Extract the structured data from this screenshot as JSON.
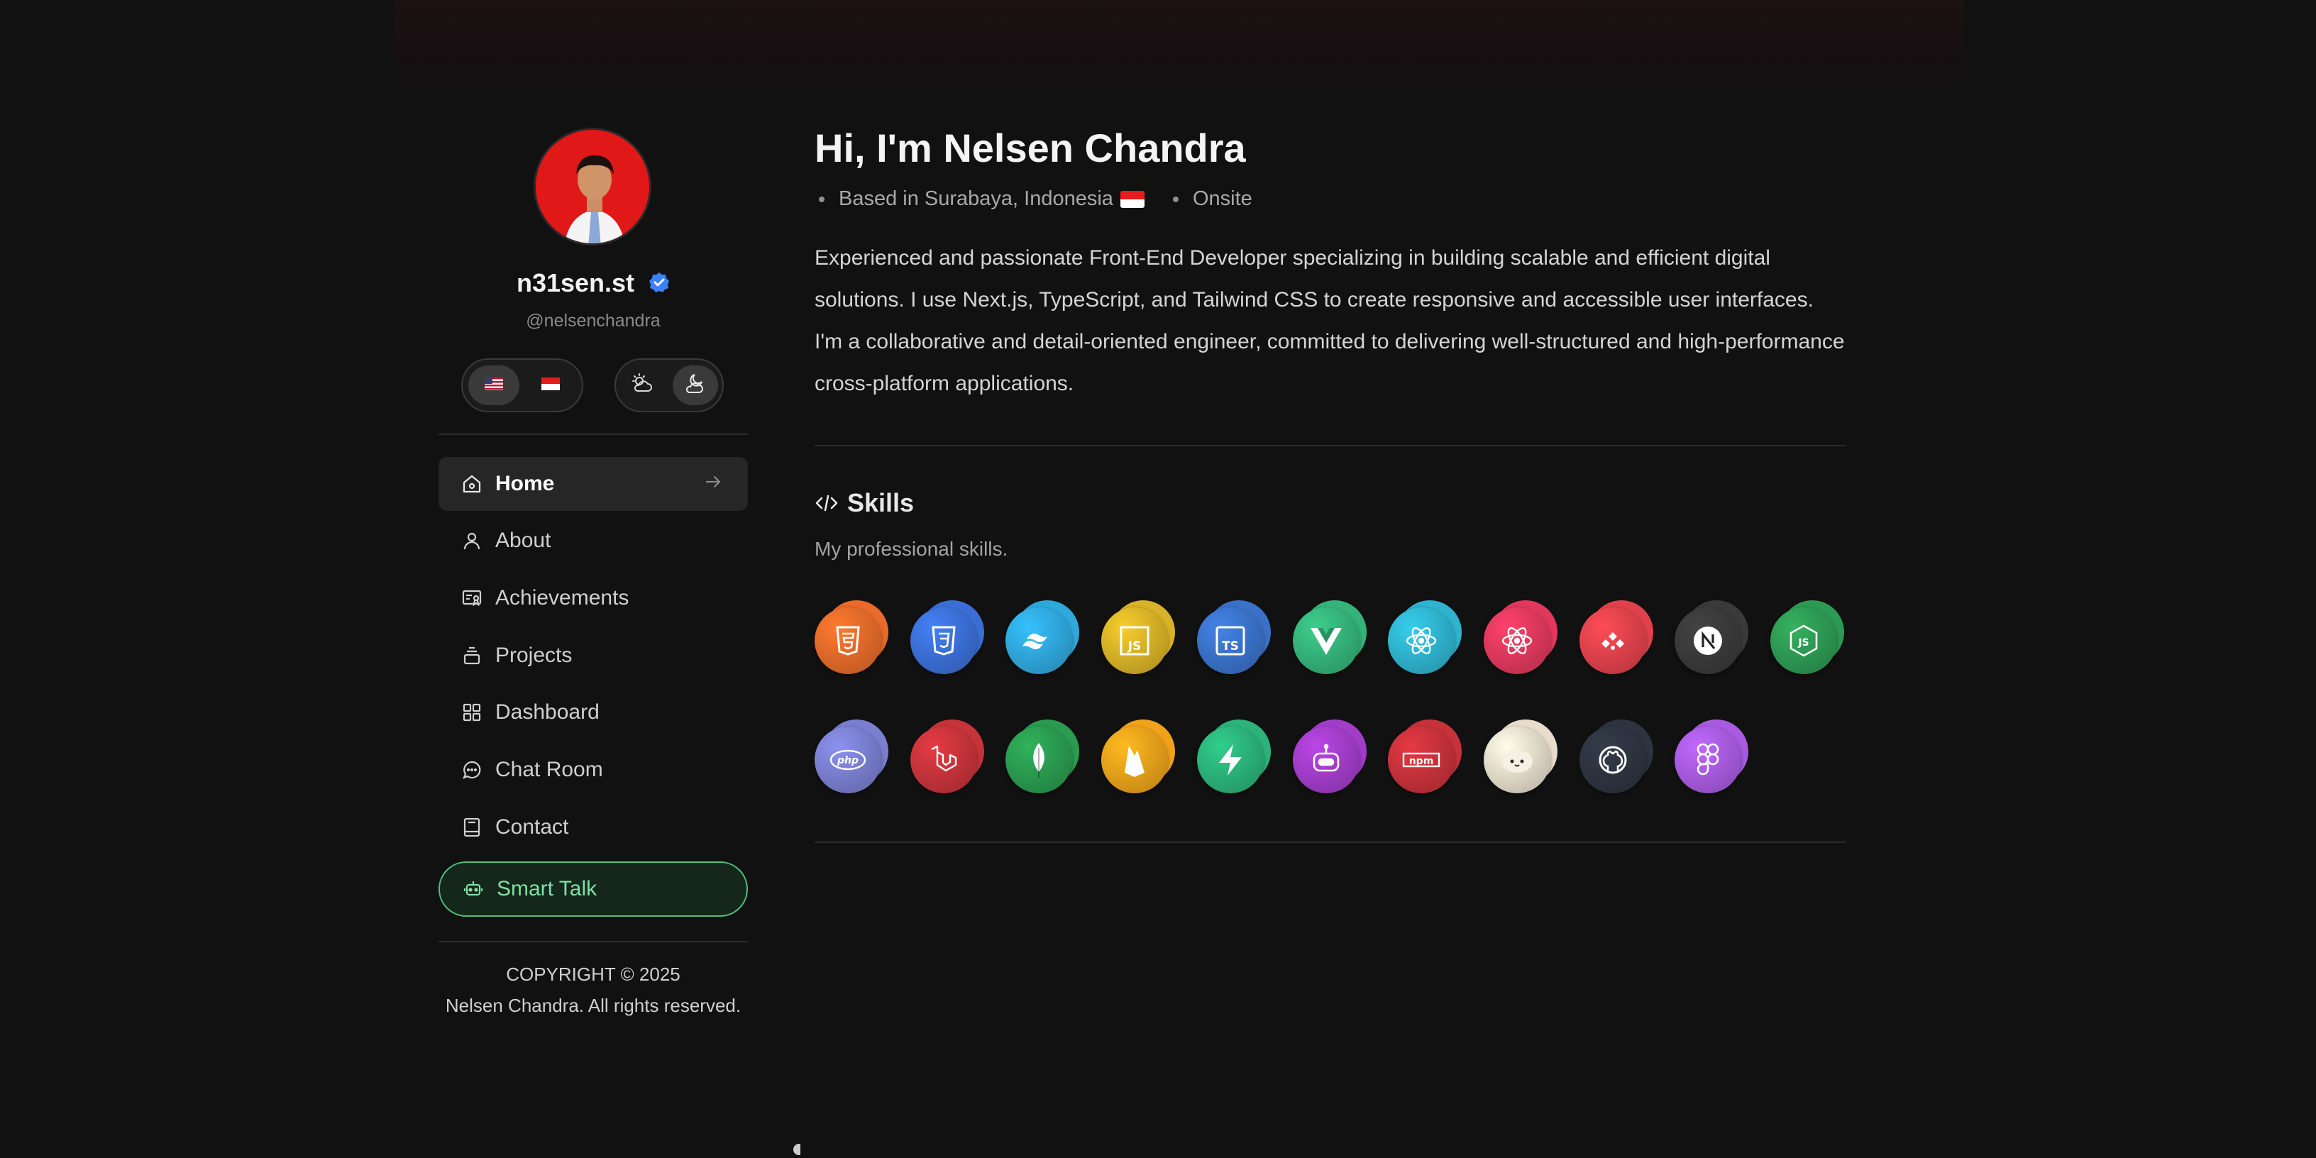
{
  "profile": {
    "username": "n31sen.st",
    "handle": "@nelsenchandra",
    "avatar_bg": "#e01818",
    "verified_color": "#3b82f6"
  },
  "language_toggle": {
    "options": [
      {
        "icon": "us-flag-icon",
        "active": true
      },
      {
        "icon": "indonesia-flag-icon",
        "active": false
      }
    ]
  },
  "theme_toggle": {
    "options": [
      {
        "icon": "sun-cloud-icon",
        "active": false
      },
      {
        "icon": "moon-cloud-icon",
        "active": true
      }
    ]
  },
  "nav": {
    "items": [
      {
        "label": "Home",
        "icon": "home-icon",
        "active": true
      },
      {
        "label": "About",
        "icon": "user-icon"
      },
      {
        "label": "Achievements",
        "icon": "certificate-icon"
      },
      {
        "label": "Projects",
        "icon": "stack-icon"
      },
      {
        "label": "Dashboard",
        "icon": "grid-icon"
      },
      {
        "label": "Chat Room",
        "icon": "chat-icon"
      },
      {
        "label": "Contact",
        "icon": "book-icon"
      }
    ],
    "smart_talk": {
      "label": "Smart Talk",
      "icon": "robot-icon",
      "accent": "#4fbf7a"
    }
  },
  "footer": {
    "copyright": "COPYRIGHT © 2025",
    "rights": "Nelsen Chandra. All rights reserved."
  },
  "main": {
    "title": "Hi, I'm Nelsen Chandra",
    "location": "Based in Surabaya, Indonesia",
    "work_mode": "Onsite",
    "bio": "Experienced and passionate Front-End Developer specializing in building scalable and efficient digital solutions. I use Next.js, TypeScript, and Tailwind CSS to create responsive and accessible user interfaces. I'm a collaborative and detail-oriented engineer, committed to delivering well-structured and high-performance cross-platform applications.",
    "skills_title": "Skills",
    "skills_subtitle": "My professional skills.",
    "skills": [
      {
        "icon": "html5-icon",
        "color": "#e96a2a"
      },
      {
        "icon": "css3-icon",
        "color": "#3b6fd6"
      },
      {
        "icon": "tailwind-icon",
        "color": "#2fa8dc"
      },
      {
        "icon": "javascript-icon",
        "color": "#d8b227"
      },
      {
        "icon": "typescript-icon",
        "color": "#3a72c9"
      },
      {
        "icon": "vue-icon",
        "color": "#35b37a"
      },
      {
        "icon": "react-icon",
        "color": "#2fb3cf"
      },
      {
        "icon": "redux-react-icon",
        "color": "#e0395d"
      },
      {
        "icon": "redux-dots-icon",
        "color": "#e0424b"
      },
      {
        "icon": "nextjs-icon",
        "color": "#3a3a3a"
      },
      {
        "icon": "nodejs-icon",
        "color": "#2d9a53"
      },
      {
        "icon": "php-icon",
        "color": "#7a7fd0"
      },
      {
        "icon": "laravel-icon",
        "color": "#c7333a"
      },
      {
        "icon": "mongodb-icon",
        "color": "#2a9b4f"
      },
      {
        "icon": "firebase-icon",
        "color": "#f1a21b"
      },
      {
        "icon": "supabase-icon",
        "color": "#2bb37a"
      },
      {
        "icon": "bot-icon",
        "color": "#a23dc9"
      },
      {
        "icon": "npm-icon",
        "color": "#c7323a"
      },
      {
        "icon": "bun-icon",
        "color": "#e8dccb"
      },
      {
        "icon": "github-icon",
        "color": "#2d3440"
      },
      {
        "icon": "figma-icon",
        "color": "#a85be0"
      }
    ]
  }
}
